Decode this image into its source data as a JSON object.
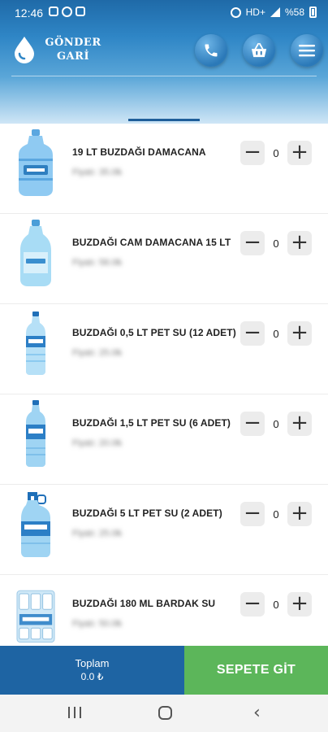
{
  "status_bar": {
    "time": "12:46",
    "network": "HD+",
    "battery": "%58"
  },
  "header": {
    "brand_line1": "GÖNDER",
    "brand_line2": "GARİ",
    "accent_color": "#2b79b8"
  },
  "products": [
    {
      "name": "19 LT BUZDAĞI DAMACANA",
      "price": "Fiyatı: 35.0₺",
      "qty": "0",
      "image": "large-water-jug-icon"
    },
    {
      "name": "BUZDAĞI CAM DAMACANA 15 LT",
      "price": "Fiyatı: 58.0₺",
      "qty": "0",
      "image": "glass-water-jug-icon"
    },
    {
      "name": "BUZDAĞI 0,5 LT PET SU (12 ADET)",
      "price": "Fiyatı: 25.0₺",
      "qty": "0",
      "image": "small-water-bottle-icon"
    },
    {
      "name": "BUZDAĞI 1,5 LT PET SU (6 ADET)",
      "price": "Fiyatı: 20.0₺",
      "qty": "0",
      "image": "water-bottle-icon"
    },
    {
      "name": "BUZDAĞI 5 LT PET SU (2 ADET)",
      "price": "Fiyatı: 25.0₺",
      "qty": "0",
      "image": "5lt-water-bottle-icon"
    },
    {
      "name": "BUZDAĞI 180 ML BARDAK SU",
      "price": "Fiyatı: 50.0₺",
      "qty": "0",
      "image": "water-cup-pack-icon"
    }
  ],
  "qty_controls": {
    "minus": "−",
    "plus": "+"
  },
  "footer": {
    "total_label": "Toplam",
    "total_value": "0.0 ₺",
    "checkout_label": "SEPETE GİT",
    "total_color": "#1e64a3",
    "checkout_color": "#5cb65a"
  }
}
